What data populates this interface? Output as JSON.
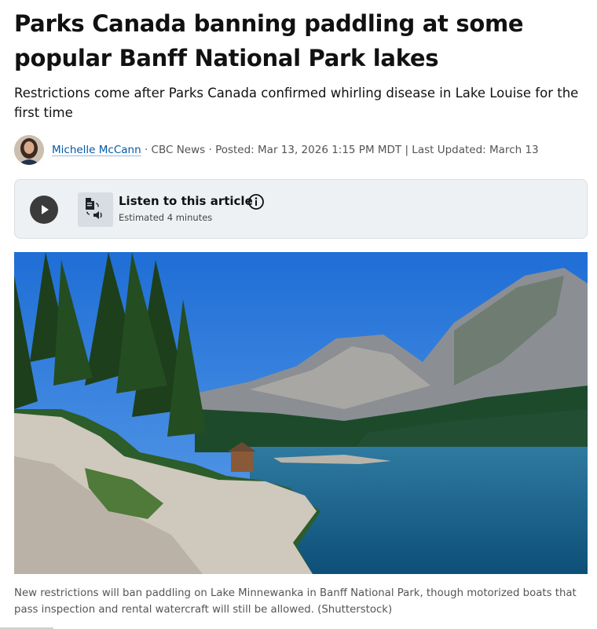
{
  "article": {
    "headline": "Parks Canada banning paddling at some popular Banff National Park lakes",
    "deck": "Restrictions come after Parks Canada confirmed whirling disease in Lake Louise for the first time"
  },
  "byline": {
    "author": "Michelle McCann",
    "outlet": " · CBC News · Posted: Mar 13, 2026 1:15 PM MDT | Last Updated: March 13"
  },
  "listen": {
    "title": "Listen to this article",
    "estimate": "Estimated 4 minutes",
    "play_icon": "play-icon",
    "audio_icon": "document-audio-icon",
    "info_icon": "info-icon"
  },
  "photo": {
    "caption": "New restrictions will ban paddling on Lake Minnewanka in Banff National Park, though motorized boats that pass inspection and rental watercraft will still be allowed. (Shutterstock)"
  },
  "colors": {
    "link": "#0059a8",
    "listen_bg": "#eef1f4",
    "play_bg": "#3b3b3b"
  }
}
